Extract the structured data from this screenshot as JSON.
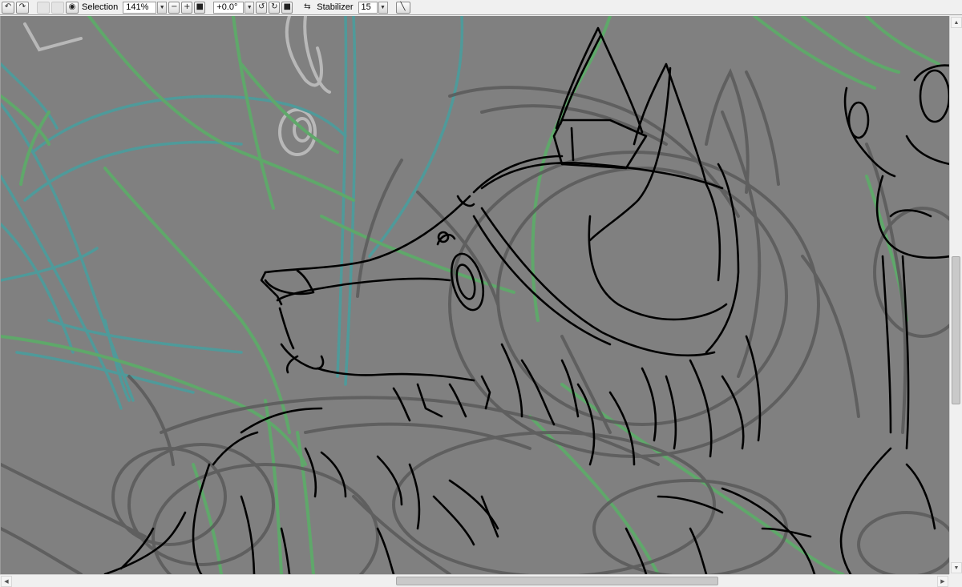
{
  "toolbar": {
    "undo_icon": "undo-icon",
    "redo_icon": "redo-icon",
    "selection_visibility_icon": "eye-icon",
    "selection_label": "Selection",
    "zoom_value": "141%",
    "zoom_out_icon": "minus-icon",
    "zoom_in_icon": "plus-icon",
    "zoom_reset_icon": "square-icon",
    "rotation_value": "+0.0°",
    "rotate_left_icon": "rotate-left-icon",
    "rotate_right_icon": "rotate-right-icon",
    "rotation_reset_icon": "square-icon",
    "flip_icon": "flip-horizontal-icon",
    "stabilizer_label": "Stabilizer",
    "stabilizer_value": "15",
    "stroke_icon": "straight-line-icon"
  },
  "canvas": {
    "background_color": "#808080",
    "line_color": "#000000",
    "rough_sketch_color": "#5a5a5a",
    "green_guide_color": "#5fa86a",
    "teal_guide_color": "#4f9a9a",
    "light_guide_color": "#b8b8b8"
  },
  "scrollbars": {
    "vertical_position": 0.45,
    "horizontal_position": 0.5
  }
}
